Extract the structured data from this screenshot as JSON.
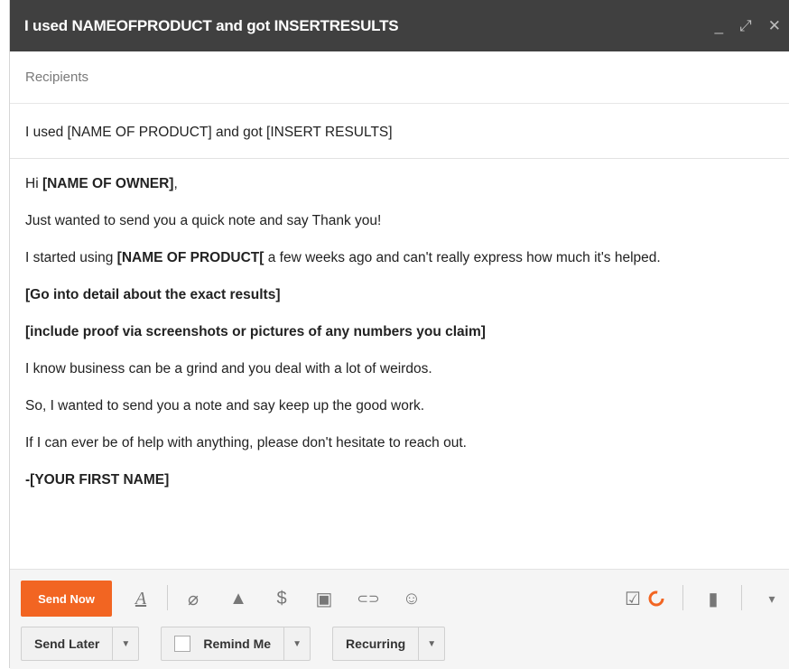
{
  "window": {
    "title": "I used NAMEOFPRODUCT and got INSERTRESULTS",
    "controls": {
      "minimize": "_",
      "expand": "⤢",
      "close": "✕"
    }
  },
  "compose": {
    "recipients_placeholder": "Recipients",
    "subject": "I used [NAME OF PRODUCT] and got [INSERT RESULTS]"
  },
  "body": {
    "greeting_pre": "Hi ",
    "greeting_bold": "[NAME OF OWNER]",
    "greeting_post": ",",
    "line1": "Just wanted to send you a quick note and say Thank you!",
    "line2_pre": "I started using ",
    "line2_bold": "[NAME OF PRODUCT[",
    "line2_post": " a few weeks ago and can't really express how much it's helped.",
    "line3": "[Go into detail about the exact results]",
    "line4": "[include proof via screenshots or pictures of any numbers you claim]",
    "line5": "I know business can be a grind and you deal with a lot of weirdos.",
    "line6": "So, I wanted to send you a note and say keep up the good work.",
    "line7": "If I can ever be of help with anything, please don't hesitate to reach out.",
    "signature": "-[YOUR FIRST NAME]"
  },
  "toolbar": {
    "send_now": "Send Now",
    "icons": {
      "format": "A",
      "attach": "⌀",
      "drive": "▲",
      "money": "$",
      "photo": "▣",
      "link": "⊂⊃",
      "emoji": "☺",
      "check": "☑",
      "trash": "▮",
      "more": "▾"
    }
  },
  "bottom": {
    "send_later": "Send Later",
    "remind_me": "Remind Me",
    "recurring": "Recurring",
    "dropdown_glyph": "▼"
  },
  "colors": {
    "titlebar": "#404040",
    "accent": "#f26522"
  }
}
